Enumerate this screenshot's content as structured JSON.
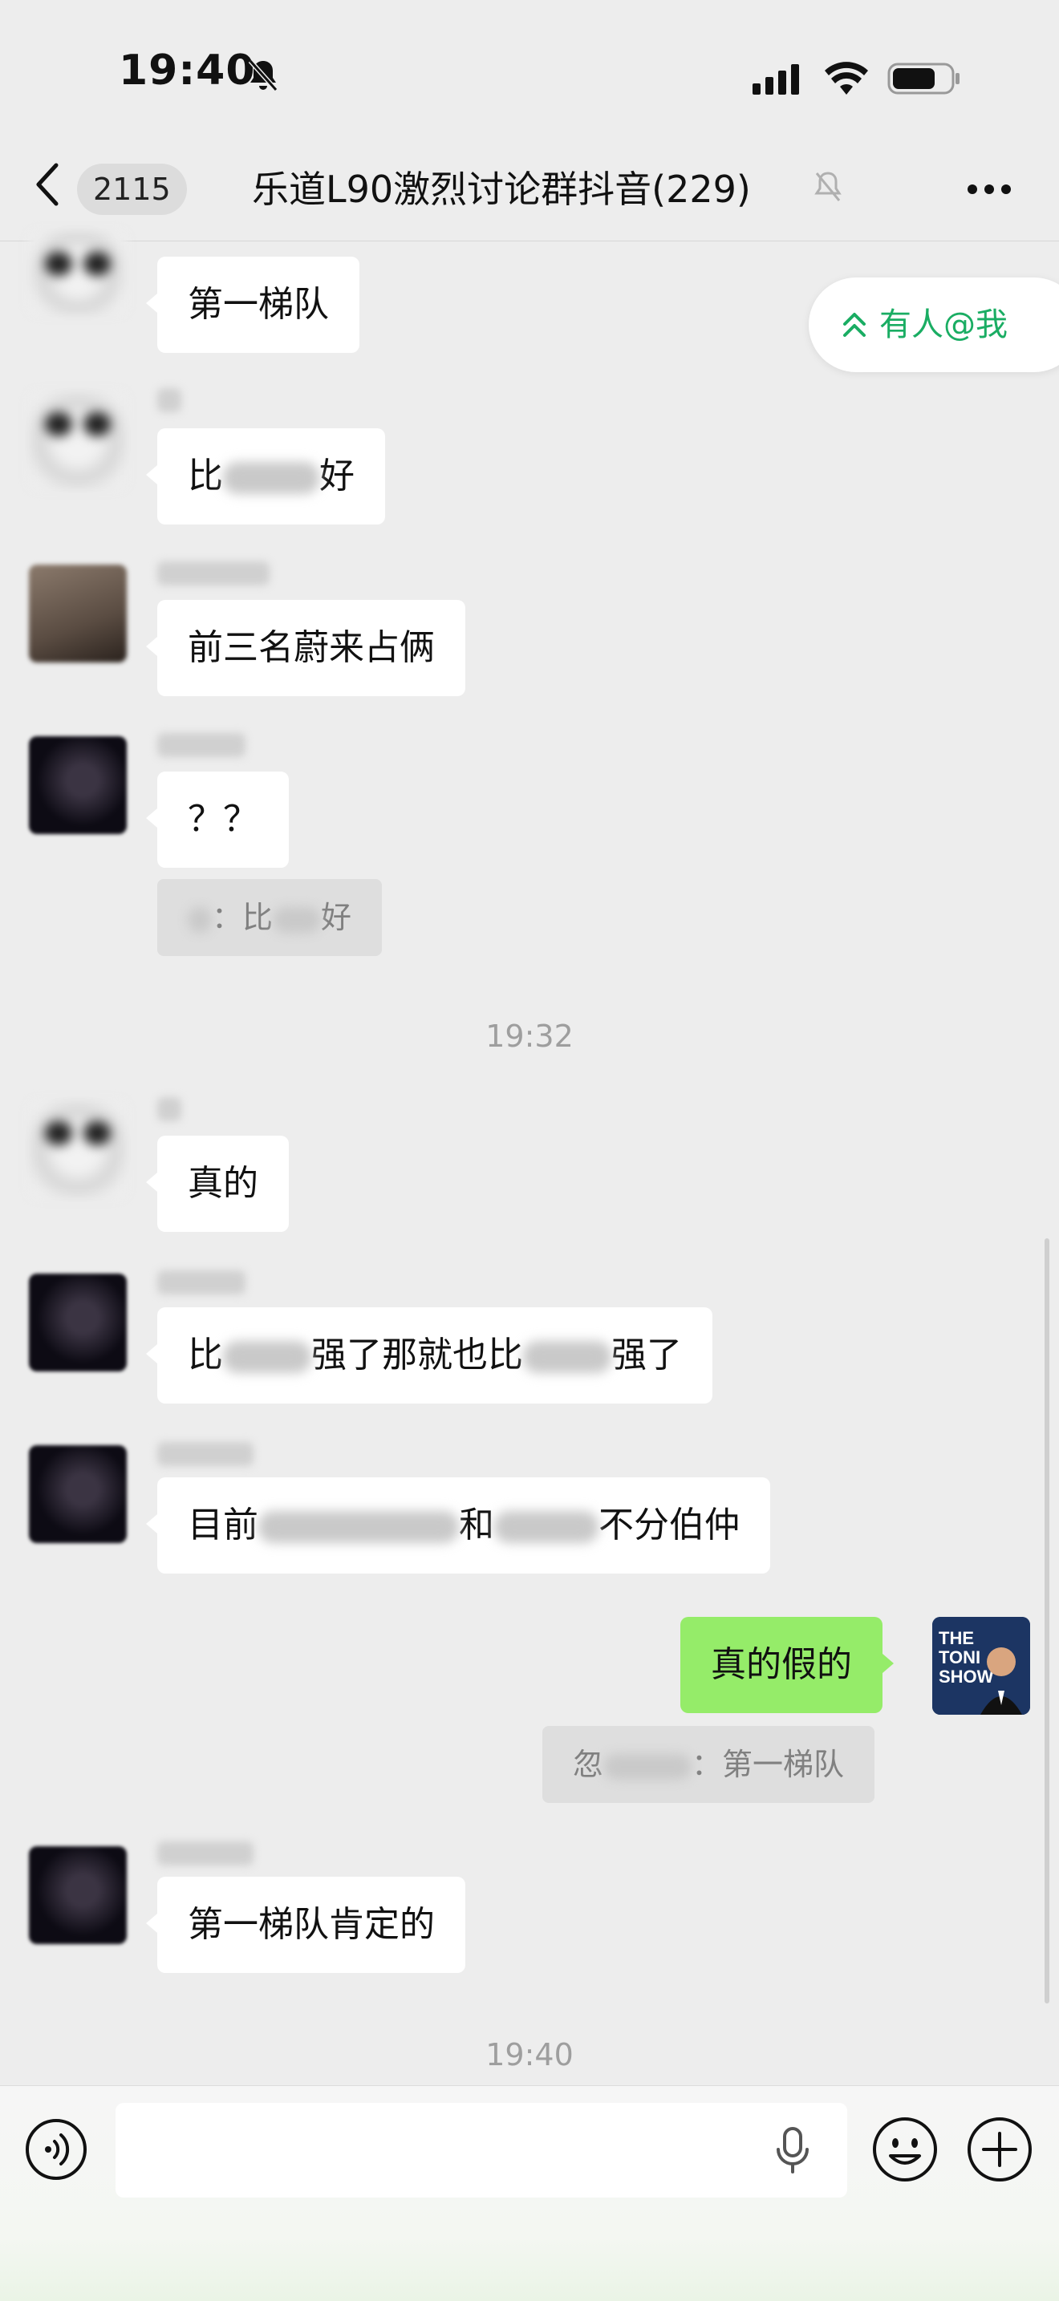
{
  "status_bar": {
    "time": "19:40",
    "icons": [
      "bell-off-icon",
      "signal-icon",
      "wifi-icon",
      "battery-icon"
    ]
  },
  "nav": {
    "back_icon": "chevron-left-icon",
    "unread_count": "2115",
    "title": "乐道L90激烈讨论群抖音(229)",
    "mute_icon": "bell-off-icon",
    "more_icon": "more-dots-icon"
  },
  "mention_pill": {
    "icon": "double-chevron-up-icon",
    "label": "有人@我"
  },
  "messages": [
    {
      "text": "第一梯队"
    },
    {
      "text_a": "比",
      "text_b": "好"
    },
    {
      "text": "前三名蔚来占俩"
    },
    {
      "text": "？？",
      "quote_a": "：比",
      "quote_b": "好"
    },
    {
      "text": "真的"
    },
    {
      "text_a": "比",
      "text_b": "强了那就也比",
      "text_c": "强了"
    },
    {
      "text_a": "目前",
      "text_b": "和",
      "text_c": "不分伯仲"
    },
    {
      "text": "真的假的",
      "quote_a": "忽",
      "quote_b": "：第一梯队"
    },
    {
      "text": "第一梯队肯定的"
    }
  ],
  "timestamps": [
    "19:32",
    "19:40"
  ],
  "input_bar": {
    "voice_icon": "voice-icon",
    "mic_icon": "mic-icon",
    "emoji_icon": "emoji-icon",
    "plus_icon": "plus-icon"
  },
  "colors": {
    "background": "#ededed",
    "self_bubble": "#95ec69",
    "accent": "#1aad63"
  }
}
